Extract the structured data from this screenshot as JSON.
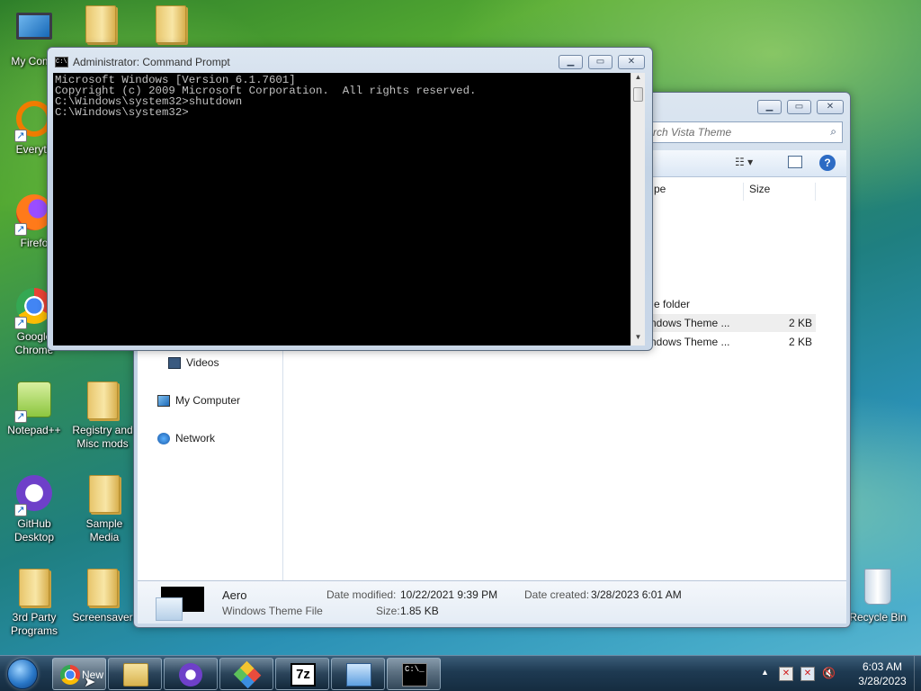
{
  "desktop_icons": [
    {
      "label": "My Comp",
      "icon": "computer-icon"
    },
    {
      "label": "Everyth",
      "icon": "everything-search-icon"
    },
    {
      "label": "Firefo",
      "icon": "firefox-icon"
    },
    {
      "label": "Google Chrome",
      "icon": "chrome-icon"
    },
    {
      "label": "Notepad++",
      "icon": "notepadpp-icon"
    },
    {
      "label": "Registry and Misc mods",
      "icon": "folder-icon"
    },
    {
      "label": "GitHub Desktop",
      "icon": "github-icon"
    },
    {
      "label": "Sample Media",
      "icon": "folder-icon"
    },
    {
      "label": "3rd Party Programs",
      "icon": "folder-icon"
    },
    {
      "label": "Screensaver",
      "icon": "folder-icon"
    },
    {
      "label": "Recycle Bin",
      "icon": "recycle-bin-icon"
    }
  ],
  "explorer": {
    "search_placeholder": "rch Vista Theme",
    "columns": [
      "pe",
      "Size"
    ],
    "rows": [
      {
        "type": "e folder",
        "size": ""
      },
      {
        "type": "ndows Theme ...",
        "size": "2 KB"
      },
      {
        "type": "ndows Theme ...",
        "size": "2 KB"
      }
    ],
    "nav": [
      "Videos",
      "My Computer",
      "Network"
    ],
    "details": {
      "name": "Aero",
      "kind": "Windows Theme File",
      "modified_label": "Date modified:",
      "modified": "10/22/2021 9:39 PM",
      "size_label": "Size:",
      "size": "1.85 KB",
      "created_label": "Date created:",
      "created": "3/28/2023 6:01 AM"
    }
  },
  "cmd": {
    "title": "Administrator: Command Prompt",
    "lines": [
      "Microsoft Windows [Version 6.1.7601]",
      "Copyright (c) 2009 Microsoft Corporation.  All rights reserved.",
      "",
      "C:\\Windows\\system32>shutdown",
      "",
      "",
      "C:\\Windows\\system32>"
    ]
  },
  "taskbar": {
    "chrome_label": "New",
    "buttons": [
      "chrome-new-tab",
      "windows-explorer",
      "github-desktop",
      "app-launcher",
      "7-zip",
      "control-panel",
      "command-prompt"
    ],
    "tray_arrow": "▲",
    "time": "6:03 AM",
    "date": "3/28/2023"
  },
  "colors": {
    "console_bg": "#000000",
    "console_fg": "#c0c0c0",
    "taskbar": "#1e3a52"
  }
}
